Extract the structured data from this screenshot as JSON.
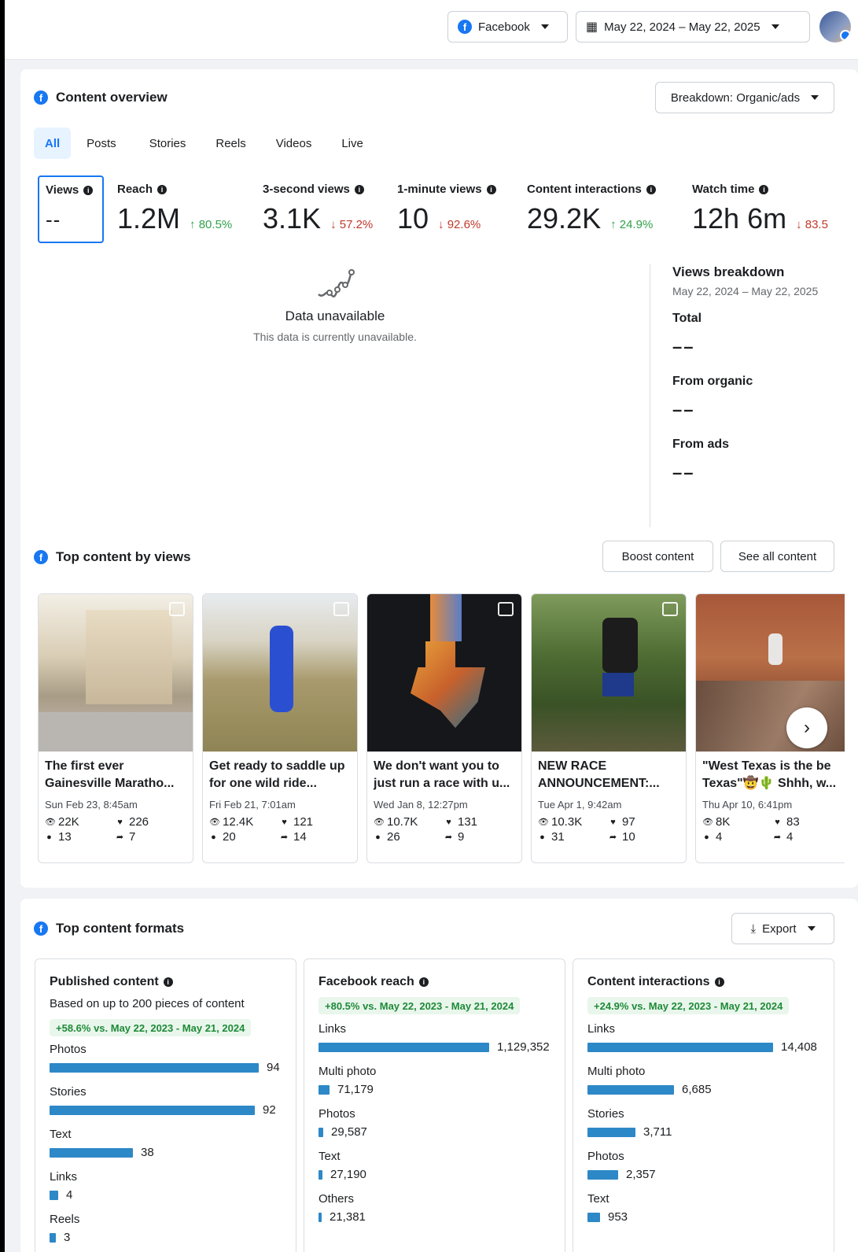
{
  "topbar": {
    "platform_label": "Facebook",
    "date_range": "May 22, 2024 – May 22, 2025"
  },
  "overview": {
    "title": "Content overview",
    "breakdown": "Breakdown: Organic/ads",
    "tabs": [
      "All",
      "Posts",
      "Stories",
      "Reels",
      "Videos",
      "Live"
    ],
    "active_tab": "All",
    "views": {
      "label": "Views",
      "value": "--"
    },
    "metrics": [
      {
        "label": "Reach",
        "value": "1.2M",
        "change": "↑ 80.5%",
        "dir": "up"
      },
      {
        "label": "3-second views",
        "value": "3.1K",
        "change": "↓ 57.2%",
        "dir": "down"
      },
      {
        "label": "1-minute views",
        "value": "10",
        "change": "↓ 92.6%",
        "dir": "down"
      },
      {
        "label": "Content interactions",
        "value": "29.2K",
        "change": "↑ 24.9%",
        "dir": "up"
      },
      {
        "label": "Watch time",
        "value": "12h 6m",
        "change": "↓ 83.5",
        "dir": "down"
      }
    ],
    "unavailable": {
      "title": "Data unavailable",
      "subtitle": "This data is currently unavailable."
    },
    "breakdown_panel": {
      "title": "Views breakdown",
      "date_range": "May 22, 2024 – May 22, 2025",
      "total_label": "Total",
      "total_value": "––",
      "organic_label": "From organic",
      "organic_value": "––",
      "ads_label": "From ads",
      "ads_value": "––"
    }
  },
  "top_content": {
    "title": "Top content by views",
    "boost_label": "Boost content",
    "see_all_label": "See all content",
    "posts": [
      {
        "caption": "The first ever Gainesville Maratho...",
        "date": "Sun Feb 23, 8:45am",
        "views": "22K",
        "reactions": "226",
        "comments": "13",
        "shares": "7"
      },
      {
        "caption": "Get ready to saddle up for one wild ride...",
        "date": "Fri Feb 21, 7:01am",
        "views": "12.4K",
        "reactions": "121",
        "comments": "20",
        "shares": "14"
      },
      {
        "caption": "We don't want you to just run a race with u...",
        "date": "Wed Jan 8, 12:27pm",
        "views": "10.7K",
        "reactions": "131",
        "comments": "26",
        "shares": "9"
      },
      {
        "caption": "NEW RACE ANNOUNCEMENT:...",
        "date": "Tue Apr 1, 9:42am",
        "views": "10.3K",
        "reactions": "97",
        "comments": "31",
        "shares": "10"
      },
      {
        "caption": "\"West Texas is the be Texas\"🤠🌵 Shhh, w...",
        "date": "Thu Apr 10, 6:41pm",
        "views": "8K",
        "reactions": "83",
        "comments": "4",
        "shares": "4"
      }
    ]
  },
  "formats": {
    "title": "Top content formats",
    "export_label": "Export",
    "published": {
      "title": "Published content",
      "subtitle": "Based on up to 200 pieces of content",
      "change": "+58.6% vs. May 22, 2023 - May 21, 2024",
      "rows": [
        {
          "label": "Photos",
          "value": "94",
          "frac": 1.0
        },
        {
          "label": "Stories",
          "value": "92",
          "frac": 0.98
        },
        {
          "label": "Text",
          "value": "38",
          "frac": 0.4
        },
        {
          "label": "Links",
          "value": "4",
          "frac": 0.04
        },
        {
          "label": "Reels",
          "value": "3",
          "frac": 0.03
        }
      ]
    },
    "reach": {
      "title": "Facebook reach",
      "change": "+80.5% vs. May 22, 2023 - May 21, 2024",
      "rows": [
        {
          "label": "Links",
          "value": "1,129,352",
          "frac": 1.0
        },
        {
          "label": "Multi photo",
          "value": "71,179",
          "frac": 0.063
        },
        {
          "label": "Photos",
          "value": "29,587",
          "frac": 0.026
        },
        {
          "label": "Text",
          "value": "27,190",
          "frac": 0.024
        },
        {
          "label": "Others",
          "value": "21,381",
          "frac": 0.019
        }
      ]
    },
    "interactions": {
      "title": "Content interactions",
      "change": "+24.9% vs. May 22, 2023 - May 21, 2024",
      "rows": [
        {
          "label": "Links",
          "value": "14,408",
          "frac": 1.0
        },
        {
          "label": "Multi photo",
          "value": "6,685",
          "frac": 0.464
        },
        {
          "label": "Stories",
          "value": "3,711",
          "frac": 0.258
        },
        {
          "label": "Photos",
          "value": "2,357",
          "frac": 0.164
        },
        {
          "label": "Text",
          "value": "953",
          "frac": 0.066
        }
      ]
    }
  },
  "colors": {
    "brand": "#1877f2",
    "bar": "#2d88c7",
    "up": "#31a24c",
    "down": "#c0392b"
  }
}
